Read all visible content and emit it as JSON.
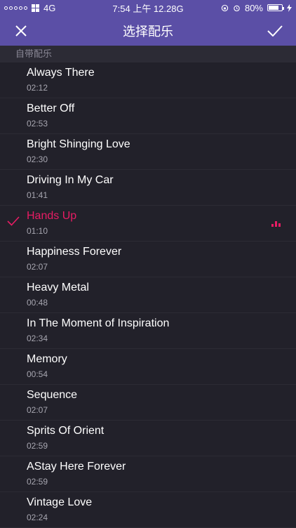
{
  "status_bar": {
    "network": "4G",
    "time": "7:54 上午 12.28G",
    "battery": "80%",
    "battery_level": 0.8
  },
  "nav": {
    "title": "选择配乐"
  },
  "section": {
    "header": "自带配乐"
  },
  "tracks": [
    {
      "title": "Always There",
      "duration": "02:12"
    },
    {
      "title": "Better Off",
      "duration": "02:53"
    },
    {
      "title": "Bright Shinging Love",
      "duration": "02:30"
    },
    {
      "title": "Driving In My Car",
      "duration": "01:41"
    },
    {
      "title": "Hands Up",
      "duration": "01:10"
    },
    {
      "title": "Happiness Forever",
      "duration": "02:07"
    },
    {
      "title": "Heavy Metal",
      "duration": "00:48"
    },
    {
      "title": "In The Moment of Inspiration",
      "duration": "02:34"
    },
    {
      "title": "Memory",
      "duration": "00:54"
    },
    {
      "title": "Sequence",
      "duration": "02:07"
    },
    {
      "title": "Sprits Of Orient",
      "duration": "02:59"
    },
    {
      "title": "AStay Here Forever",
      "duration": "02:59"
    },
    {
      "title": "Vintage Love",
      "duration": "02:24"
    }
  ],
  "selected_index": 4,
  "colors": {
    "accent": "#e81c64",
    "nav_background": "#5b4fa6",
    "list_background": "#22212a"
  },
  "icons": {
    "close": "close-icon",
    "confirm": "checkmark-icon",
    "selected": "checkmark-icon",
    "playing": "equalizer-icon"
  }
}
